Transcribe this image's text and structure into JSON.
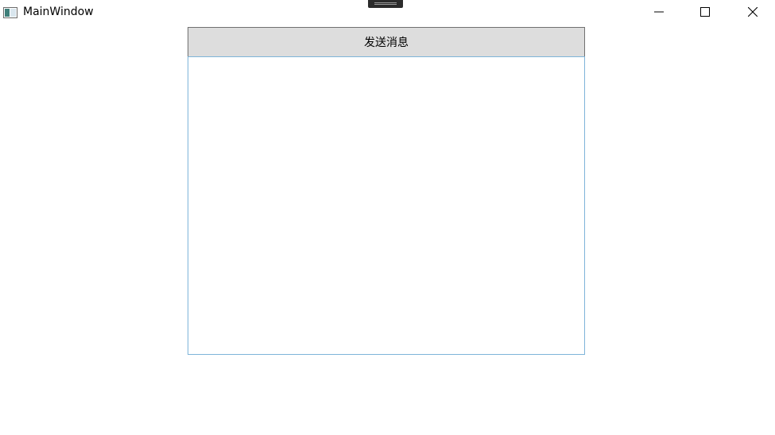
{
  "window": {
    "title": "MainWindow"
  },
  "icons": {
    "app": "app-window-icon",
    "minimize": "minimize-icon",
    "maximize": "maximize-icon",
    "close": "close-icon",
    "debug_toolbar": "debug-toolbar-grip-icon"
  },
  "main": {
    "send_button_label": "发送消息",
    "message_box_value": ""
  },
  "colors": {
    "button_bg": "#dddddd",
    "button_border": "#707070",
    "textbox_border": "#7eb4d9"
  }
}
